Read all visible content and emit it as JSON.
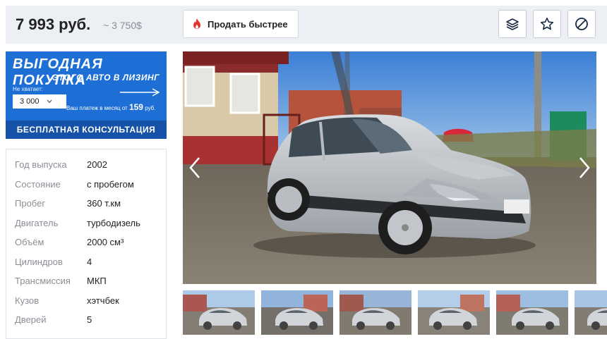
{
  "price": {
    "main": "7 993 руб.",
    "usd": "~ 3 750$"
  },
  "toolbar": {
    "sell_label": "Продать быстрее",
    "icons": [
      "layers-icon",
      "star-icon",
      "block-icon"
    ]
  },
  "promo": {
    "title": "ВЫГОДНАЯ ПОКУПКА",
    "subtitle": "ЭТОГО АВТО В ЛИЗИНГ",
    "lack_label": "Не хватает:",
    "amount": "3 000",
    "payment_prefix": "Ваш платеж в месяц от",
    "payment_amount": "159",
    "payment_unit": "руб.",
    "cta": "БЕСПЛАТНАЯ КОНСУЛЬТАЦИЯ"
  },
  "specs": [
    {
      "label": "Год выпуска",
      "value": "2002"
    },
    {
      "label": "Состояние",
      "value": "с пробегом"
    },
    {
      "label": "Пробег",
      "value": "360 т.км"
    },
    {
      "label": "Двигатель",
      "value": "турбодизель"
    },
    {
      "label": "Объём",
      "value": "2000 см³"
    },
    {
      "label": "Цилиндров",
      "value": "4"
    },
    {
      "label": "Трансмиссия",
      "value": "МКП"
    },
    {
      "label": "Кузов",
      "value": "хэтчбек"
    },
    {
      "label": "Дверей",
      "value": "5"
    }
  ],
  "colors": {
    "promo_blue": "#1d6fd6",
    "promo_dark": "#1653a8",
    "car_silver": "#c3c7cc"
  }
}
